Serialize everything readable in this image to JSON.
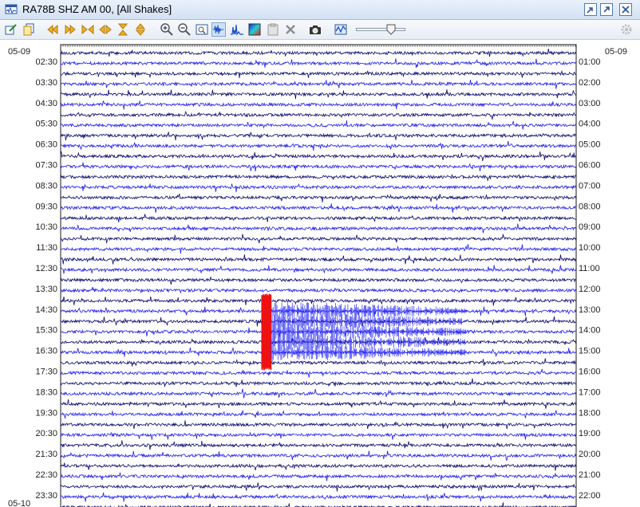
{
  "window": {
    "title": "RA78B SHZ AM 00, [All Shakes]"
  },
  "toolbar": {
    "buttons": [
      {
        "name": "edit-icon",
        "active": false
      },
      {
        "name": "copy-icon",
        "active": false
      },
      {
        "name": "rewind-icon",
        "active": false
      },
      {
        "name": "fast-forward-icon",
        "active": false
      },
      {
        "name": "compress-horizontal-icon",
        "active": false
      },
      {
        "name": "expand-horizontal-icon",
        "active": false
      },
      {
        "name": "compress-vertical-icon",
        "active": false
      },
      {
        "name": "expand-vertical-icon",
        "active": false
      },
      {
        "name": "zoom-in-icon",
        "active": false
      },
      {
        "name": "zoom-out-icon",
        "active": false
      },
      {
        "name": "fit-icon",
        "active": false
      },
      {
        "name": "waveform-icon",
        "active": true
      },
      {
        "name": "spectrum-icon",
        "active": false
      },
      {
        "name": "spectrogram-icon",
        "active": false
      },
      {
        "name": "clipboard-icon",
        "active": false
      },
      {
        "name": "delete-icon",
        "active": false
      },
      {
        "name": "camera-icon",
        "active": false
      },
      {
        "name": "filter-icon",
        "active": false
      },
      {
        "name": "settings-icon",
        "active": false
      }
    ],
    "zoom_level": 0.7
  },
  "helicorder": {
    "date_top_left": "05-09",
    "date_top_right": "05-09",
    "date_bottom_left": "05-10",
    "left_time_labels": [
      "02:30",
      "03:30",
      "04:30",
      "05:30",
      "06:30",
      "07:30",
      "08:30",
      "09:30",
      "10:30",
      "11:30",
      "12:30",
      "13:30",
      "14:30",
      "15:30",
      "16:30",
      "17:30",
      "18:30",
      "19:30",
      "20:30",
      "21:30",
      "22:30",
      "23:30"
    ],
    "right_time_labels": [
      "01:00",
      "02:00",
      "03:00",
      "04:00",
      "05:00",
      "06:00",
      "07:00",
      "08:00",
      "09:00",
      "10:00",
      "11:00",
      "12:00",
      "13:00",
      "14:00",
      "15:00",
      "16:00",
      "17:00",
      "18:00",
      "19:00",
      "20:00",
      "21:00",
      "22:00"
    ],
    "traces_per_hour": 2,
    "trace_colors": [
      "#0a0a6e",
      "#1d1df0"
    ],
    "event_color": "#ee1111",
    "event": {
      "trace_start": 24,
      "trace_end": 30,
      "position": 0.39,
      "coda_length": 0.38
    }
  }
}
